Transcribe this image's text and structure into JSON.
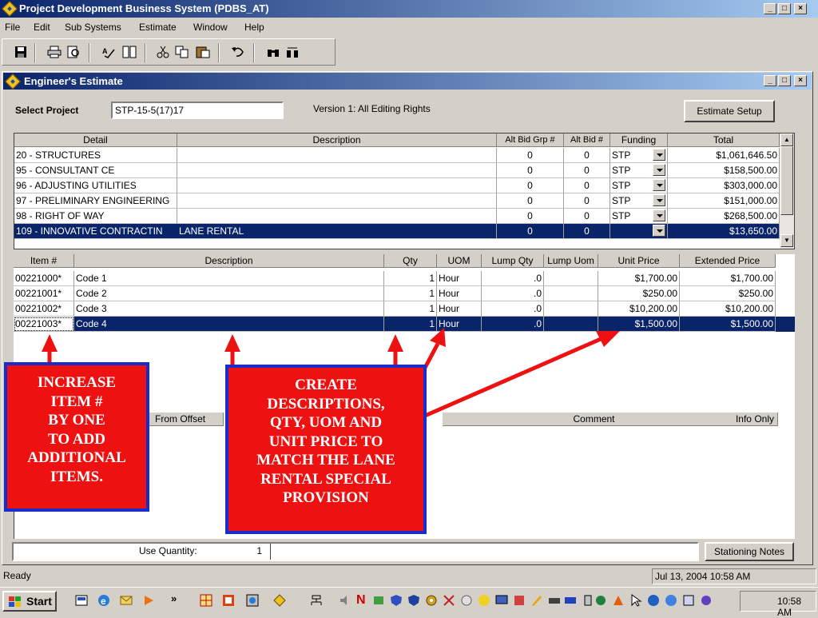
{
  "window": {
    "title": "Project Development Business System (PDBS_AT)",
    "min_glyph": "_",
    "max_glyph": "□",
    "close_glyph": "×"
  },
  "menu": [
    "File",
    "Edit",
    "Sub Systems",
    "Estimate",
    "Window",
    "Help"
  ],
  "toolbar_icons": [
    "save-icon",
    "print-icon",
    "print-preview-icon",
    "spell-check-icon",
    "columns-icon",
    "cut-icon",
    "copy-icon",
    "paste-icon",
    "undo-icon",
    "find-icon",
    "find-replace-icon"
  ],
  "child": {
    "title": "Engineer's Estimate"
  },
  "project": {
    "label": "Select Project",
    "value": "STP-15-5(17)17",
    "version_text": "Version 1: All Editing Rights",
    "estimate_setup": "Estimate Setup"
  },
  "upper_grid": {
    "headers": [
      "Detail",
      "Description",
      "Alt Bid Grp #",
      "Alt Bid #",
      "Funding",
      "Total"
    ],
    "rows": [
      {
        "detail": "20 - STRUCTURES",
        "description": "",
        "alt_grp": "0",
        "alt_bid": "0",
        "funding": "STP",
        "total": "$1,061,646.50"
      },
      {
        "detail": "95 - CONSULTANT CE",
        "description": "",
        "alt_grp": "0",
        "alt_bid": "0",
        "funding": "STP",
        "total": "$158,500.00"
      },
      {
        "detail": "96 - ADJUSTING UTILITIES",
        "description": "",
        "alt_grp": "0",
        "alt_bid": "0",
        "funding": "STP",
        "total": "$303,000.00"
      },
      {
        "detail": "97 - PRELIMINARY ENGINEERING",
        "description": "",
        "alt_grp": "0",
        "alt_bid": "0",
        "funding": "STP",
        "total": "$151,000.00"
      },
      {
        "detail": "98 - RIGHT OF WAY",
        "description": "",
        "alt_grp": "0",
        "alt_bid": "0",
        "funding": "STP",
        "total": "$268,500.00"
      },
      {
        "detail": "109 - INNOVATIVE CONTRACTIN",
        "description": "LANE RENTAL",
        "alt_grp": "0",
        "alt_bid": "0",
        "funding": "",
        "total": "$13,650.00"
      }
    ],
    "selected_index": 5
  },
  "lower_grid": {
    "headers": [
      "Item #",
      "Description",
      "Qty",
      "UOM",
      "Lump Qty",
      "Lump Uom",
      "Unit Price",
      "Extended Price"
    ],
    "rows": [
      {
        "item": "00221000*",
        "description": "Code 1",
        "qty": "1",
        "uom": "Hour",
        "lump_qty": ".0",
        "lump_uom": "",
        "unit_price": "$1,700.00",
        "extended": "$1,700.00"
      },
      {
        "item": "00221001*",
        "description": "Code 2",
        "qty": "1",
        "uom": "Hour",
        "lump_qty": ".0",
        "lump_uom": "",
        "unit_price": "$250.00",
        "extended": "$250.00"
      },
      {
        "item": "00221002*",
        "description": "Code 3",
        "qty": "1",
        "uom": "Hour",
        "lump_qty": ".0",
        "lump_uom": "",
        "unit_price": "$10,200.00",
        "extended": "$10,200.00"
      },
      {
        "item": "00221003*",
        "description": "Code 4",
        "qty": "1",
        "uom": "Hour",
        "lump_qty": ".0",
        "lump_uom": "",
        "unit_price": "$1,500.00",
        "extended": "$1,500.00"
      }
    ],
    "selected_index": 3
  },
  "stationing_grid": {
    "headers": [
      "From Offset",
      "Comment",
      "Info Only"
    ]
  },
  "bottom": {
    "use_quantity_label": "Use Quantity:",
    "use_quantity_value": "1",
    "stationing_notes": "Stationing Notes"
  },
  "callouts": {
    "left": [
      "INCREASE",
      "ITEM #",
      "BY ONE",
      "TO ADD",
      "ADDITIONAL",
      "ITEMS."
    ],
    "right": [
      "CREATE",
      "DESCRIPTIONS,",
      "QTY, UOM AND",
      "UNIT PRICE  TO",
      "MATCH  THE LANE",
      "RENTAL SPECIAL",
      "PROVISION"
    ],
    "fill_color": "#ee1111",
    "border_color": "#1a2ccc",
    "arrow_color": "#ee1111"
  },
  "status": {
    "text": "Ready",
    "datetime": "Jul 13, 2004 10:58 AM"
  },
  "taskbar": {
    "start": "Start",
    "clock": "10:58 AM"
  },
  "colors": {
    "title_active": "#0a246a",
    "selection": "#0a246a",
    "face": "#d4d0c8"
  }
}
